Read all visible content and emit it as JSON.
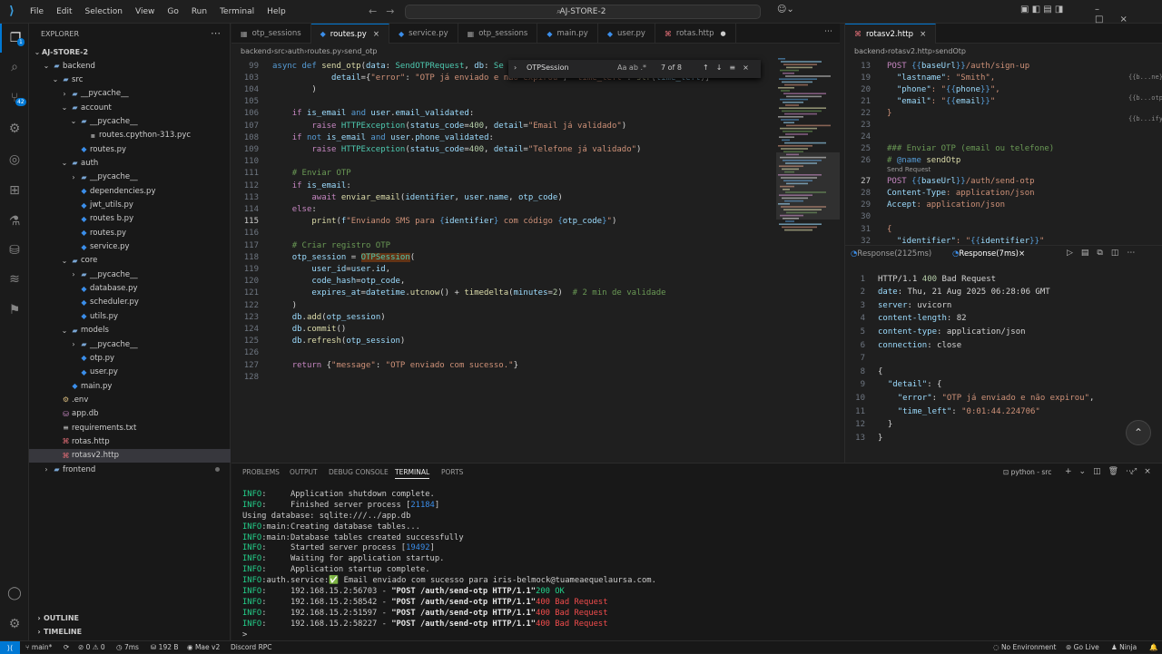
{
  "titlebar": {
    "menus": [
      "File",
      "Edit",
      "Selection",
      "View",
      "Go",
      "Run",
      "Terminal",
      "Help"
    ],
    "search": "AJ-STORE-2"
  },
  "explorer": {
    "title": "EXPLORER",
    "root": "AJ-STORE-2",
    "tree": [
      {
        "label": "backend",
        "depth": 1,
        "type": "folder",
        "open": true
      },
      {
        "label": "src",
        "depth": 2,
        "type": "folder",
        "open": true
      },
      {
        "label": "__pycache__",
        "depth": 3,
        "type": "folder",
        "open": false
      },
      {
        "label": "account",
        "depth": 3,
        "type": "folder",
        "open": true
      },
      {
        "label": "__pycache__",
        "depth": 4,
        "type": "folder",
        "open": true
      },
      {
        "label": "routes.cpython-313.pyc",
        "depth": 5,
        "type": "file"
      },
      {
        "label": "routes.py",
        "depth": 4,
        "type": "py"
      },
      {
        "label": "auth",
        "depth": 3,
        "type": "folder",
        "open": true
      },
      {
        "label": "__pycache__",
        "depth": 4,
        "type": "folder",
        "open": false
      },
      {
        "label": "dependencies.py",
        "depth": 4,
        "type": "py"
      },
      {
        "label": "jwt_utils.py",
        "depth": 4,
        "type": "py"
      },
      {
        "label": "routes b.py",
        "depth": 4,
        "type": "py"
      },
      {
        "label": "routes.py",
        "depth": 4,
        "type": "py"
      },
      {
        "label": "service.py",
        "depth": 4,
        "type": "py"
      },
      {
        "label": "core",
        "depth": 3,
        "type": "folder",
        "open": true
      },
      {
        "label": "__pycache__",
        "depth": 4,
        "type": "folder",
        "open": false
      },
      {
        "label": "database.py",
        "depth": 4,
        "type": "py"
      },
      {
        "label": "scheduler.py",
        "depth": 4,
        "type": "py"
      },
      {
        "label": "utils.py",
        "depth": 4,
        "type": "py"
      },
      {
        "label": "models",
        "depth": 3,
        "type": "folder",
        "open": true
      },
      {
        "label": "__pycache__",
        "depth": 4,
        "type": "folder",
        "open": false
      },
      {
        "label": "otp.py",
        "depth": 4,
        "type": "py"
      },
      {
        "label": "user.py",
        "depth": 4,
        "type": "py"
      },
      {
        "label": "main.py",
        "depth": 3,
        "type": "py"
      },
      {
        "label": ".env",
        "depth": 2,
        "type": "env"
      },
      {
        "label": "app.db",
        "depth": 2,
        "type": "db"
      },
      {
        "label": "requirements.txt",
        "depth": 2,
        "type": "txt"
      },
      {
        "label": "rotas.http",
        "depth": 2,
        "type": "http"
      },
      {
        "label": "rotasv2.http",
        "depth": 2,
        "type": "http",
        "selected": true
      },
      {
        "label": "frontend",
        "depth": 1,
        "type": "folder",
        "open": false
      }
    ],
    "outline": "OUTLINE",
    "timeline": "TIMELINE"
  },
  "editor1": {
    "tabs": [
      {
        "label": "otp_sessions",
        "icon": "table-icon"
      },
      {
        "label": "routes.py",
        "icon": "python-icon",
        "active": true,
        "close": "×"
      },
      {
        "label": "service.py",
        "icon": "python-icon"
      },
      {
        "label": "otp_sessions",
        "icon": "table-icon"
      },
      {
        "label": "main.py",
        "icon": "python-icon"
      },
      {
        "label": "user.py",
        "icon": "python-icon"
      },
      {
        "label": "rotas.http",
        "icon": "http-icon",
        "dirty": true
      }
    ],
    "breadcrumb": [
      "backend",
      "src",
      "auth",
      "routes.py",
      "send_otp"
    ],
    "find": {
      "query": "OTPSession",
      "options": "Aa  ab  .*",
      "count": "7 of 8"
    },
    "lines": [
      {
        "n": "99",
        "code": "async def send_otp(data: SendOTPRequest, db: Se"
      },
      {
        "n": "103",
        "code": "            detail={\"error\": \"OTP já enviado e não expirou\", \"time_left\": str(time_left)}"
      },
      {
        "n": "104",
        "code": "        )"
      },
      {
        "n": "105",
        "code": ""
      },
      {
        "n": "106",
        "code": "    if is_email and user.email_validated:"
      },
      {
        "n": "107",
        "code": "        raise HTTPException(status_code=400, detail=\"Email já validado\")"
      },
      {
        "n": "108",
        "code": "    if not is_email and user.phone_validated:"
      },
      {
        "n": "109",
        "code": "        raise HTTPException(status_code=400, detail=\"Telefone já validado\")"
      },
      {
        "n": "110",
        "code": ""
      },
      {
        "n": "111",
        "code": "    # Enviar OTP"
      },
      {
        "n": "112",
        "code": "    if is_email:"
      },
      {
        "n": "113",
        "code": "        await enviar_email(identifier, user.name, otp_code)"
      },
      {
        "n": "114",
        "code": "    else:"
      },
      {
        "n": "115",
        "code": "        print(f\"Enviando SMS para {identifier} com código {otp_code}\")"
      },
      {
        "n": "116",
        "code": ""
      },
      {
        "n": "117",
        "code": "    # Criar registro OTP"
      },
      {
        "n": "118",
        "code": "    otp_session = OTPSession("
      },
      {
        "n": "119",
        "code": "        user_id=user.id,"
      },
      {
        "n": "120",
        "code": "        code_hash=otp_code,"
      },
      {
        "n": "121",
        "code": "        expires_at=datetime.utcnow() + timedelta(minutes=2)  # 2 min de validade"
      },
      {
        "n": "122",
        "code": "    )"
      },
      {
        "n": "123",
        "code": "    db.add(otp_session)"
      },
      {
        "n": "124",
        "code": "    db.commit()"
      },
      {
        "n": "125",
        "code": "    db.refresh(otp_session)"
      },
      {
        "n": "126",
        "code": ""
      },
      {
        "n": "127",
        "code": "    return {\"message\": \"OTP enviado com sucesso.\"}"
      },
      {
        "n": "128",
        "code": ""
      }
    ]
  },
  "editor2": {
    "tab": "rotasv2.http",
    "breadcrumb": [
      "backend",
      "rotasv2.http",
      "sendOtp"
    ],
    "codelens": "Send Request",
    "lines": [
      {
        "n": "13",
        "code": "POST {{baseUrl}}/auth/sign-up"
      },
      {
        "n": "19",
        "code": "  \"lastname\": \"Smith\","
      },
      {
        "n": "20",
        "code": "  \"phone\": \"{{phone}}\","
      },
      {
        "n": "21",
        "code": "  \"email\": \"{{email}}\""
      },
      {
        "n": "22",
        "code": "}"
      },
      {
        "n": "23",
        "code": ""
      },
      {
        "n": "24",
        "code": ""
      },
      {
        "n": "25",
        "code": "### Enviar OTP (email ou telefone)"
      },
      {
        "n": "26",
        "code": "# @name sendOtp"
      },
      {
        "n": "27",
        "code": "POST {{baseUrl}}/auth/send-otp"
      },
      {
        "n": "28",
        "code": "Content-Type: application/json"
      },
      {
        "n": "29",
        "code": "Accept: application/json"
      },
      {
        "n": "30",
        "code": ""
      },
      {
        "n": "31",
        "code": "{"
      },
      {
        "n": "32",
        "code": "  \"identifier\": \"{{identifier}}\""
      }
    ],
    "side_hints": [
      "{{b...ne}}",
      "{{b...otp",
      "{{b...ify"
    ]
  },
  "response": {
    "tabs": [
      {
        "label": "Response(2125ms)",
        "active": false
      },
      {
        "label": "Response(7ms)",
        "active": true
      }
    ],
    "lines": [
      {
        "n": "1",
        "code": "HTTP/1.1 400 Bad Request"
      },
      {
        "n": "2",
        "code": "date: Thu, 21 Aug 2025 06:28:06 GMT"
      },
      {
        "n": "3",
        "code": "server: uvicorn"
      },
      {
        "n": "4",
        "code": "content-length: 82"
      },
      {
        "n": "5",
        "code": "content-type: application/json"
      },
      {
        "n": "6",
        "code": "connection: close"
      },
      {
        "n": "7",
        "code": ""
      },
      {
        "n": "8",
        "code": "{"
      },
      {
        "n": "9",
        "code": "  \"detail\": {"
      },
      {
        "n": "10",
        "code": "    \"error\": \"OTP já enviado e não expirou\","
      },
      {
        "n": "11",
        "code": "    \"time_left\": \"0:01:44.224706\""
      },
      {
        "n": "12",
        "code": "  }"
      },
      {
        "n": "13",
        "code": "}"
      }
    ]
  },
  "panel": {
    "tabs": [
      "PROBLEMS",
      "OUTPUT",
      "DEBUG CONSOLE",
      "TERMINAL",
      "PORTS"
    ],
    "active_tab": "TERMINAL",
    "shell": "python - src",
    "terminal": [
      "INFO:     Application shutdown complete.",
      "INFO:     Finished server process [21184]",
      "Using database: sqlite:///../app.db",
      "INFO:main:Creating database tables...",
      "INFO:main:Database tables created successfully",
      "INFO:     Started server process [19492]",
      "INFO:     Waiting for application startup.",
      "INFO:     Application startup complete.",
      "INFO:auth.service:✅ Email enviado com sucesso para iris-belmock@tuameaequelaursa.com.",
      "INFO:     192.168.15.2:56703 - \"POST /auth/send-otp HTTP/1.1\" 200 OK",
      "INFO:     192.168.15.2:58542 - \"POST /auth/send-otp HTTP/1.1\" 400 Bad Request",
      "INFO:     192.168.15.2:51597 - \"POST /auth/send-otp HTTP/1.1\" 400 Bad Request",
      "INFO:     192.168.15.2:58227 - \"POST /auth/send-otp HTTP/1.1\" 400 Bad Request",
      ">"
    ]
  },
  "statusbar": {
    "branch": "main*",
    "problems": "⊘ 0 ⚠ 0",
    "timing": "7ms",
    "size": "192 B",
    "user": "Mae v2",
    "discord": "Discord RPC",
    "environment": "No Environment",
    "golive": "Go Live",
    "ninja": "Ninja"
  },
  "colors": {
    "accent": "#0078d4",
    "background": "#1f1f1f",
    "sidebar": "#181818"
  }
}
